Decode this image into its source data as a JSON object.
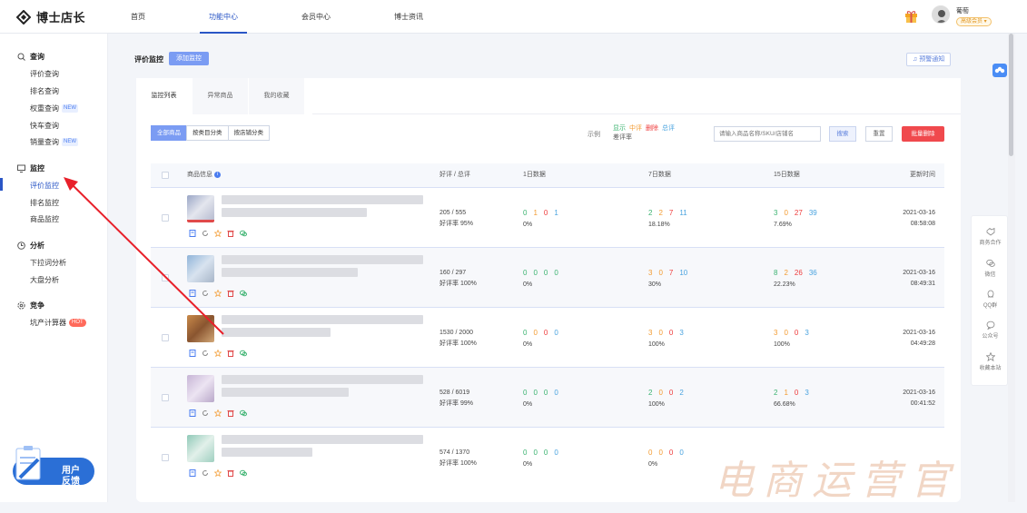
{
  "app": {
    "logo_text": "博士店长"
  },
  "nav": [
    {
      "label": "首页"
    },
    {
      "label": "功能中心"
    },
    {
      "label": "会员中心"
    },
    {
      "label": "博士资讯"
    }
  ],
  "user": {
    "name": "葡萄",
    "badge": "高级会员 ▾"
  },
  "sidebar": {
    "groups": [
      {
        "title": "查询",
        "icon": "search-icon",
        "items": [
          {
            "label": "评价查询",
            "tag": ""
          },
          {
            "label": "排名查询",
            "tag": ""
          },
          {
            "label": "权重查询",
            "tag": "NEW"
          },
          {
            "label": "快车查询",
            "tag": ""
          },
          {
            "label": "销量查询",
            "tag": "NEW"
          }
        ]
      },
      {
        "title": "监控",
        "icon": "monitor-icon",
        "items": [
          {
            "label": "评价监控",
            "tag": ""
          },
          {
            "label": "排名监控",
            "tag": ""
          },
          {
            "label": "商品监控",
            "tag": ""
          }
        ]
      },
      {
        "title": "分析",
        "icon": "clock-icon",
        "items": [
          {
            "label": "下拉词分析",
            "tag": ""
          },
          {
            "label": "大盘分析",
            "tag": ""
          }
        ]
      },
      {
        "title": "竞争",
        "icon": "gear-icon",
        "items": [
          {
            "label": "坑产计算器",
            "tag": "HOT"
          }
        ]
      }
    ],
    "feedback_label_1": "用户",
    "feedback_label_2": "反馈"
  },
  "page": {
    "title": "评价监控",
    "add_button": "添加监控",
    "alert_button": "♫ 预警通知",
    "tabs": [
      {
        "label": "监控列表"
      },
      {
        "label": "异常商品"
      },
      {
        "label": "我的收藏"
      }
    ],
    "filters": [
      {
        "label": "全部商品"
      },
      {
        "label": "按类目分类"
      },
      {
        "label": "按店铺分类"
      }
    ],
    "legend_label": "示例",
    "legend": {
      "show": "显示",
      "middle": "中评",
      "delete": "删除",
      "total": "总评",
      "bad": "差评率"
    },
    "search_placeholder": "请输入商品名称/SKU/店铺名",
    "search_button": "搜索",
    "reset_button": "重置",
    "batch_delete_button": "批量删除"
  },
  "table": {
    "headers": {
      "product": "商品信息",
      "rate": "好评 / 总评",
      "d1": "1日数据",
      "d7": "7日数据",
      "d15": "15日数据",
      "updated": "更新时间"
    },
    "rows": [
      {
        "rate": "205 / 555",
        "rate_pct": "好评率 95%",
        "d1": [
          "0",
          "1",
          "0",
          "1"
        ],
        "d1_pct": "0%",
        "d7": [
          "2",
          "2",
          "7",
          "11"
        ],
        "d7_pct": "18.18%",
        "d15": [
          "3",
          "0",
          "27",
          "39"
        ],
        "d15_pct": "7.69%",
        "date": "2021-03-16",
        "time": "08:58:08"
      },
      {
        "rate": "160 / 297",
        "rate_pct": "好评率 100%",
        "d1": [
          "0",
          "0",
          "0",
          "0"
        ],
        "d1_pct": "0%",
        "d7": [
          "3",
          "0",
          "7",
          "10"
        ],
        "d7_pct": "30%",
        "d15": [
          "8",
          "2",
          "26",
          "36"
        ],
        "d15_pct": "22.23%",
        "date": "2021-03-16",
        "time": "08:49:31"
      },
      {
        "rate": "1530 / 2000",
        "rate_pct": "好评率 100%",
        "d1": [
          "0",
          "0",
          "0",
          "0"
        ],
        "d1_pct": "0%",
        "d7": [
          "3",
          "0",
          "0",
          "3"
        ],
        "d7_pct": "100%",
        "d15": [
          "3",
          "0",
          "0",
          "3"
        ],
        "d15_pct": "100%",
        "date": "2021-03-16",
        "time": "04:49:28"
      },
      {
        "rate": "528 / 6019",
        "rate_pct": "好评率 99%",
        "d1": [
          "0",
          "0",
          "0",
          "0"
        ],
        "d1_pct": "0%",
        "d7": [
          "2",
          "0",
          "0",
          "2"
        ],
        "d7_pct": "100%",
        "d15": [
          "2",
          "1",
          "0",
          "3"
        ],
        "d15_pct": "66.68%",
        "date": "2021-03-16",
        "time": "00:41:52"
      },
      {
        "rate": "574 / 1370",
        "rate_pct": "好评率 100%",
        "d1": [
          "0",
          "0",
          "0",
          "0"
        ],
        "d1_pct": "0%",
        "d7": [
          "0",
          "0",
          "0",
          "0"
        ],
        "d7_pct": "0%",
        "d15": [
          "",
          "",
          "",
          ""
        ],
        "d15_pct": "",
        "date": "",
        "time": ""
      }
    ]
  },
  "right_float": [
    {
      "label": "商务合作"
    },
    {
      "label": "微信"
    },
    {
      "label": "QQ群"
    },
    {
      "label": "公众号"
    },
    {
      "label": "收藏本站"
    }
  ],
  "watermark": "电商运营官",
  "colors": {
    "accent": "#2a56c6",
    "primary_button": "#7b9cf3",
    "danger": "#f0494d",
    "green": "#3cb371",
    "orange": "#f39c33",
    "red": "#ee3b3b",
    "blue": "#4aa3df"
  }
}
